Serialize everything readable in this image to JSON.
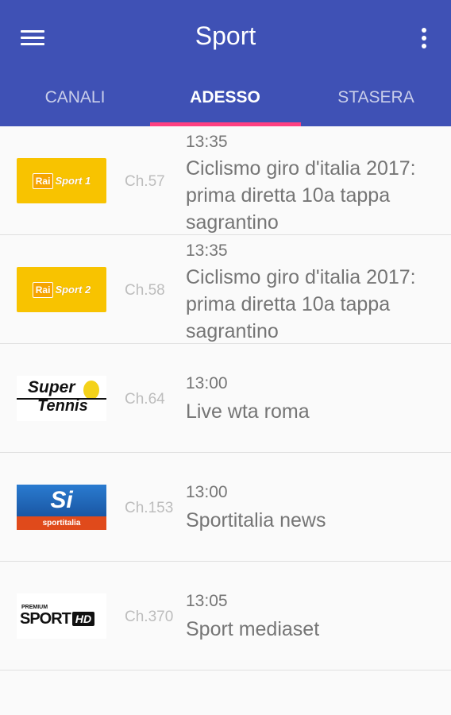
{
  "header": {
    "title": "Sport"
  },
  "tabs": [
    {
      "label": "CANALI",
      "active": false
    },
    {
      "label": "ADESSO",
      "active": true
    },
    {
      "label": "STASERA",
      "active": false
    }
  ],
  "colors": {
    "app_bar": "#3f51b5",
    "accent": "#ff4081",
    "text_secondary": "#757575",
    "text_hint": "#bdbdbd"
  },
  "channels": [
    {
      "logo": {
        "name": "rai-sport-1-logo",
        "box_text": "Rai",
        "text": "Sport 1"
      },
      "channel": "Ch.57",
      "time": "13:35",
      "program": "Ciclismo giro d'italia 2017: prima diretta 10a tappa sagrantino"
    },
    {
      "logo": {
        "name": "rai-sport-2-logo",
        "box_text": "Rai",
        "text": "Sport 2"
      },
      "channel": "Ch.58",
      "time": "13:35",
      "program": "Ciclismo giro d'italia 2017: prima diretta 10a tappa sagrantino"
    },
    {
      "logo": {
        "name": "supertennis-logo",
        "word1": "Super",
        "word2": "Tennis"
      },
      "channel": "Ch.64",
      "time": "13:00",
      "program": "Live wta roma"
    },
    {
      "logo": {
        "name": "sportitalia-logo",
        "mark": "Si",
        "text": "sportitalia"
      },
      "channel": "Ch.153",
      "time": "13:00",
      "program": "Sportitalia news"
    },
    {
      "logo": {
        "name": "premium-sport-hd-logo",
        "small": "PREMIUM",
        "main": "SPORT",
        "badge": "HD"
      },
      "channel": "Ch.370",
      "time": "13:05",
      "program": "Sport mediaset"
    }
  ]
}
